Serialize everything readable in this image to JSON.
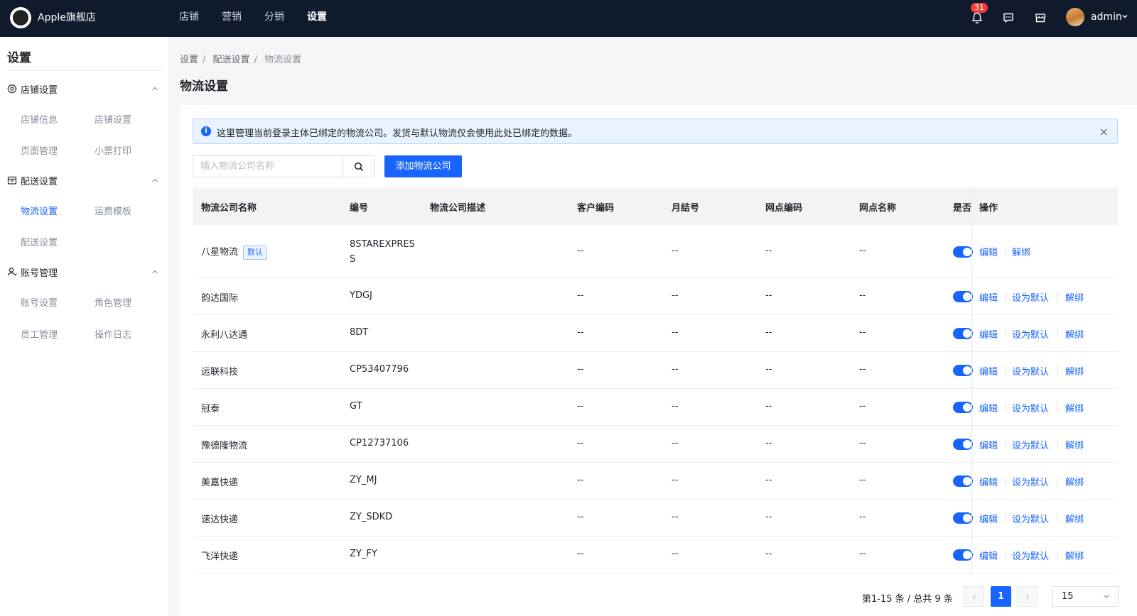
{
  "header": {
    "shop_name": "Apple旗舰店",
    "nav": [
      "店铺",
      "营销",
      "分销",
      "设置"
    ],
    "notification_count": "31",
    "user_name": "admin"
  },
  "sidebar": {
    "title": "设置",
    "groups": [
      {
        "label": "店铺设置",
        "items": [
          "店铺信息",
          "店铺设置",
          "页面管理",
          "小票打印"
        ]
      },
      {
        "label": "配送设置",
        "items": [
          "物流设置",
          "运费模板",
          "配送设置"
        ]
      },
      {
        "label": "账号管理",
        "items": [
          "账号设置",
          "角色管理",
          "员工管理",
          "操作日志"
        ]
      }
    ]
  },
  "breadcrumb": [
    "设置",
    "配送设置",
    "物流设置"
  ],
  "page_title": "物流设置",
  "alert": {
    "text": "这里管理当前登录主体已绑定的物流公司。发货与默认物流仅会使用此处已绑定的数据。"
  },
  "search": {
    "placeholder": "输入物流公司名称"
  },
  "add_button": "添加物流公司",
  "table": {
    "columns": [
      "物流公司名称",
      "编号",
      "物流公司描述",
      "客户编码",
      "月结号",
      "网点编码",
      "网点名称",
      "是否",
      "操作"
    ],
    "default_tag": "默认",
    "dash": "--",
    "actions": {
      "edit": "编辑",
      "set_default": "设为默认",
      "unbind": "解绑"
    },
    "rows": [
      {
        "name": "八星物流",
        "code_line1": "8STAREXPRES",
        "code_line2": "S",
        "is_default": true,
        "enabled": true
      },
      {
        "name": "韵达国际",
        "code": "YDGJ",
        "is_default": false,
        "enabled": true
      },
      {
        "name": "永利八达通",
        "code": "8DT",
        "is_default": false,
        "enabled": true
      },
      {
        "name": "运联科技",
        "code": "CP53407796",
        "is_default": false,
        "enabled": true
      },
      {
        "name": "冠泰",
        "code": "GT",
        "is_default": false,
        "enabled": true
      },
      {
        "name": "豫德隆物流",
        "code": "CP12737106",
        "is_default": false,
        "enabled": true
      },
      {
        "name": "美嘉快递",
        "code": "ZY_MJ",
        "is_default": false,
        "enabled": true
      },
      {
        "name": "速达快递",
        "code": "ZY_SDKD",
        "is_default": false,
        "enabled": true
      },
      {
        "name": "飞洋快递",
        "code": "ZY_FY",
        "is_default": false,
        "enabled": true
      }
    ]
  },
  "pagination": {
    "summary": "第1-15 条 / 总共 9 条",
    "current_page": "1",
    "page_size": "15",
    "prev_icon": "chevron-left-icon",
    "next_icon": "chevron-right-icon"
  },
  "colors": {
    "primary": "#1764ff",
    "topbar": "#0f1b2d",
    "badge": "#f23c3c"
  }
}
